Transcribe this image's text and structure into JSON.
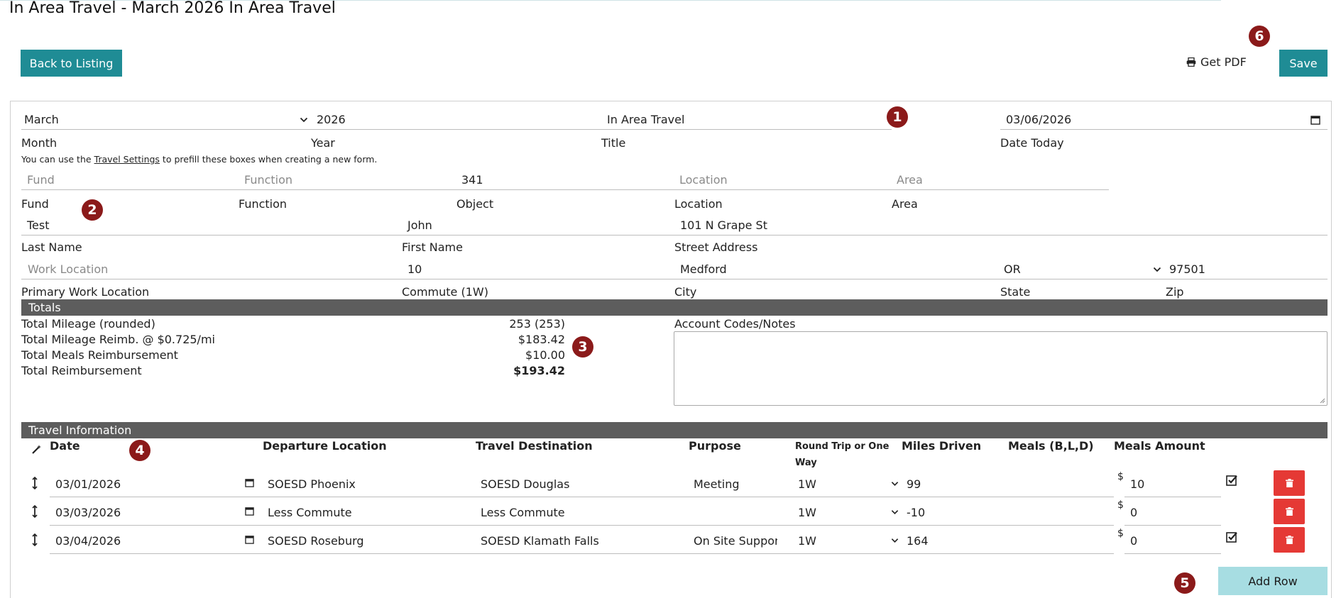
{
  "page": {
    "title": "In Area Travel - March 2026 In Area Travel"
  },
  "actions": {
    "back_label": "Back to Listing",
    "pdf_label": "Get PDF",
    "save_label": "Save"
  },
  "badges": [
    "1",
    "2",
    "3",
    "4",
    "5",
    "6"
  ],
  "header_form": {
    "month": {
      "value": "March",
      "label": "Month"
    },
    "year": {
      "value": "2026",
      "label": "Year"
    },
    "title": {
      "value": "In Area Travel",
      "label": "Title"
    },
    "date_today": {
      "value": "03/06/2026",
      "label": "Date Today"
    },
    "note_prefix": "You can use the ",
    "note_link": "Travel Settings",
    "note_suffix": " to prefill these boxes when creating a new form."
  },
  "account_fields": {
    "fund": {
      "placeholder": "Fund",
      "label": "Fund"
    },
    "function": {
      "placeholder": "Function",
      "label": "Function"
    },
    "object": {
      "value": "341",
      "label": "Object"
    },
    "location": {
      "placeholder": "Location",
      "label": "Location"
    },
    "area": {
      "placeholder": "Area",
      "label": "Area"
    }
  },
  "person": {
    "last_name": {
      "value": "Test",
      "label": "Last Name"
    },
    "first_name": {
      "value": "John",
      "label": "First Name"
    },
    "street": {
      "value": "101 N Grape St",
      "label": "Street Address"
    },
    "work_location": {
      "placeholder": "Work Location",
      "label": "Primary Work Location"
    },
    "commute": {
      "value": "10",
      "label": "Commute (1W)"
    },
    "city": {
      "value": "Medford",
      "label": "City"
    },
    "state": {
      "value": "OR",
      "label": "State"
    },
    "zip": {
      "value": "97501",
      "label": "Zip"
    }
  },
  "totals": {
    "header": "Totals",
    "rows": [
      {
        "label": "Total Mileage (rounded)",
        "value": "253 (253)"
      },
      {
        "label": "Total Mileage Reimb. @ $0.725/mi",
        "value": "$183.42"
      },
      {
        "label": "Total Meals Reimbursement",
        "value": "$10.00"
      },
      {
        "label": "Total Reimbursement",
        "value": "$193.42"
      }
    ],
    "notes_label": "Account Codes/Notes"
  },
  "travel": {
    "header": "Travel Information",
    "columns": {
      "date": "Date",
      "departure": "Departure Location",
      "destination": "Travel Destination",
      "purpose": "Purpose",
      "round_trip_line1": "Round Trip or One",
      "round_trip_line2": "Way",
      "miles": "Miles Driven",
      "meals": "Meals (B,L,D)",
      "meals_amount": "Meals Amount"
    },
    "currency_symbol": "$",
    "rows": [
      {
        "date": "03/01/2026",
        "departure": "SOESD Phoenix",
        "destination": "SOESD Douglas",
        "purpose": "Meeting",
        "trip": "1W",
        "miles": "99",
        "meals": "",
        "amount": "10",
        "checked": true
      },
      {
        "date": "03/03/2026",
        "departure": "Less Commute",
        "destination": "Less Commute",
        "purpose": "",
        "trip": "1W",
        "miles": "-10",
        "meals": "",
        "amount": "0",
        "checked": false
      },
      {
        "date": "03/04/2026",
        "departure": "SOESD Roseburg",
        "destination": "SOESD Klamath Falls",
        "purpose": "On Site Suppor",
        "trip": "1W",
        "miles": "164",
        "meals": "",
        "amount": "0",
        "checked": true
      }
    ],
    "add_row_label": "Add Row"
  },
  "colors": {
    "teal": "#1f8c95",
    "badge": "#8b1a1a",
    "section_bar": "#5d5d5d",
    "delete": "#e53935",
    "add_row": "#a7dde2"
  },
  "icons": [
    "printer-icon",
    "chevron-down-icon",
    "calendar-icon",
    "magic-wand-icon",
    "drag-handle-icon",
    "checkbox-icon",
    "trash-icon"
  ]
}
